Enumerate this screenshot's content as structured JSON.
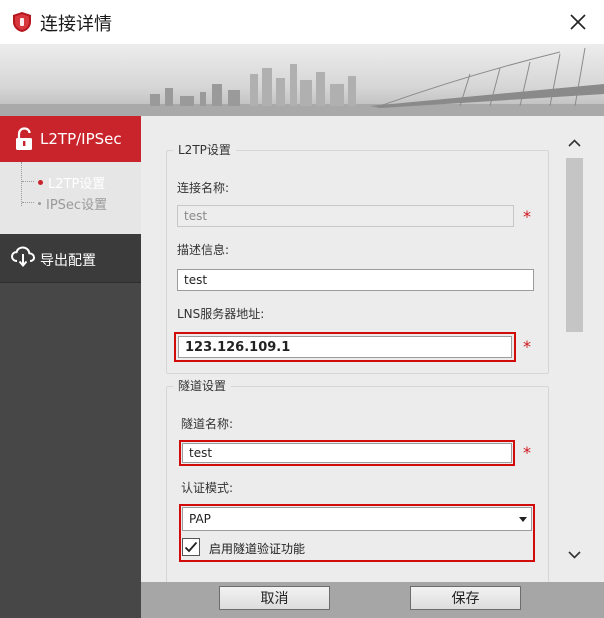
{
  "window": {
    "title": "连接详情"
  },
  "sidebar": {
    "main_item": "L2TP/IPSec",
    "sub_items": [
      {
        "label": "L2TP设置",
        "active": true
      },
      {
        "label": "IPSec设置",
        "active": false
      }
    ],
    "export_item": "导出配置"
  },
  "l2tp_group": {
    "legend": "L2TP设置",
    "conn_name_label": "连接名称:",
    "conn_name_value": "test",
    "desc_label": "描述信息:",
    "desc_value": "test",
    "lns_label": "LNS服务器地址:",
    "lns_value": "123.126.109.1",
    "required_mark": "*"
  },
  "tunnel_group": {
    "legend": "隧道设置",
    "tunnel_name_label": "隧道名称:",
    "tunnel_name_value": "test",
    "auth_mode_label": "认证模式:",
    "auth_mode_value": "PAP",
    "tunnel_verify_label": "启用隧道验证功能",
    "tunnel_verify_checked": true,
    "required_mark": "*"
  },
  "buttons": {
    "cancel": "取消",
    "save": "保存"
  },
  "colors": {
    "accent": "#c9242c",
    "highlight": "#d10a0a",
    "sidebar_bg": "#474747"
  }
}
